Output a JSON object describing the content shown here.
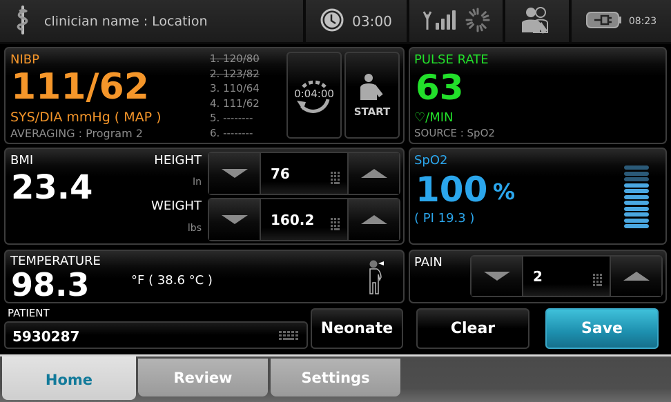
{
  "header": {
    "clinician_location": "clinician name : Location",
    "interval_timer": "03:00",
    "battery_time": "08:23",
    "icons": [
      "caduceus-icon",
      "clock-icon",
      "wireless-signal-icon",
      "loading-spinner-icon",
      "clinician-patient-icon",
      "battery-plug-icon"
    ]
  },
  "nibp": {
    "label": "NIBP",
    "value": "111/62",
    "units": "SYS/DIA mmHg ( MAP )",
    "averaging": "AVERAGING : Program 2",
    "history": [
      {
        "text": "1. 120/80",
        "excluded": true
      },
      {
        "text": "2. 123/82",
        "excluded": true
      },
      {
        "text": "3. 110/64",
        "excluded": false
      },
      {
        "text": "4. 111/62",
        "excluded": false
      },
      {
        "text": "5. --------",
        "excluded": false
      },
      {
        "text": "6. --------",
        "excluded": false
      }
    ],
    "interval_button": "0:04:00",
    "start_button": "START",
    "color": "#f5962a"
  },
  "pulse": {
    "label": "PULSE RATE",
    "value": "63",
    "units": "♡/MIN",
    "source": "SOURCE : SpO2",
    "color": "#22e02a"
  },
  "bmi": {
    "label": "BMI",
    "value": "23.4",
    "height_label": "HEIGHT",
    "height_unit": "In",
    "height_value": "76",
    "weight_label": "WEIGHT",
    "weight_unit": "lbs",
    "weight_value": "160.2"
  },
  "spo2": {
    "label": "SpO2",
    "value": "100",
    "unit": "%",
    "pi": "( PI 19.3 )",
    "signal_segments_total": 11,
    "signal_segments_lit": 8,
    "color": "#2ba6ec"
  },
  "temperature": {
    "label": "TEMPERATURE",
    "value": "98.3",
    "units": "°F  ( 38.6 °C )"
  },
  "pain": {
    "label": "PAIN",
    "value": "2"
  },
  "patient": {
    "label": "PATIENT",
    "id": "5930287"
  },
  "actions": {
    "neonate": "Neonate",
    "clear": "Clear",
    "save": "Save",
    "save_color": "#1d8fae"
  },
  "tabs": [
    {
      "label": "Home",
      "active": true
    },
    {
      "label": "Review",
      "active": false
    },
    {
      "label": "Settings",
      "active": false
    }
  ]
}
